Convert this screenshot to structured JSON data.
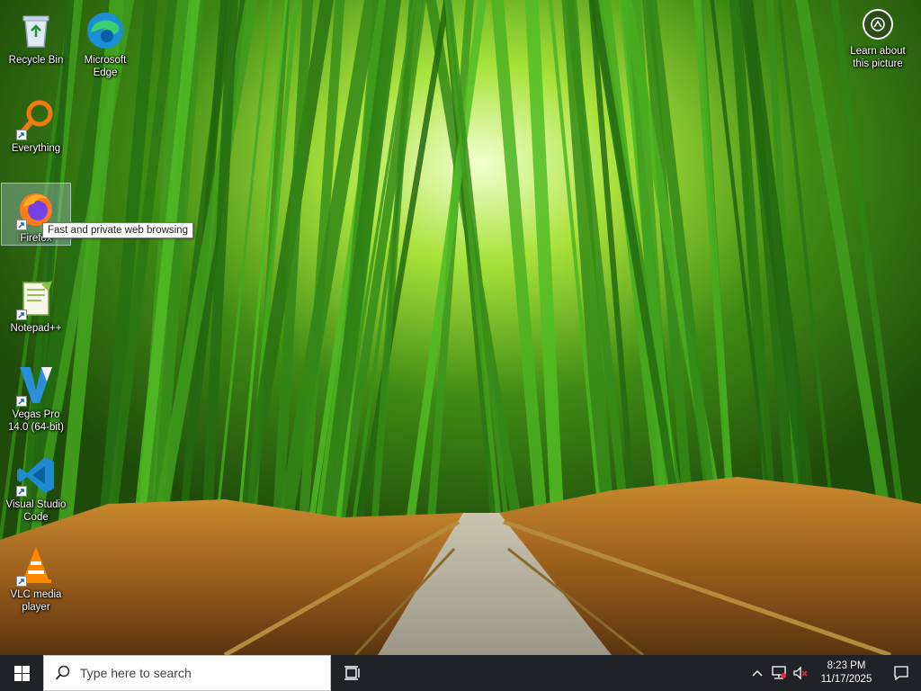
{
  "desktop": {
    "icons": [
      {
        "label": "Recycle Bin",
        "icon": "recycle-bin-icon"
      },
      {
        "label": "Microsoft Edge",
        "icon": "edge-icon"
      },
      {
        "label": "Everything",
        "icon": "everything-icon"
      },
      {
        "label": "Firefox",
        "icon": "firefox-icon"
      },
      {
        "label": "Notepad++",
        "icon": "notepad-plus-plus-icon"
      },
      {
        "label": "Vegas Pro 14.0 (64-bit)",
        "icon": "vegas-pro-icon"
      },
      {
        "label": "Visual Studio Code",
        "icon": "vscode-icon"
      },
      {
        "label": "VLC media player",
        "icon": "vlc-icon"
      }
    ],
    "tooltip": "Fast and private web browsing",
    "learn_label": "Learn about this picture"
  },
  "taskbar": {
    "search_placeholder": "Type here to search",
    "time": "8:23 PM",
    "date": "11/17/2025"
  },
  "colors": {
    "taskbar_bg": "#1f2227",
    "search_bg": "#ffffff"
  }
}
